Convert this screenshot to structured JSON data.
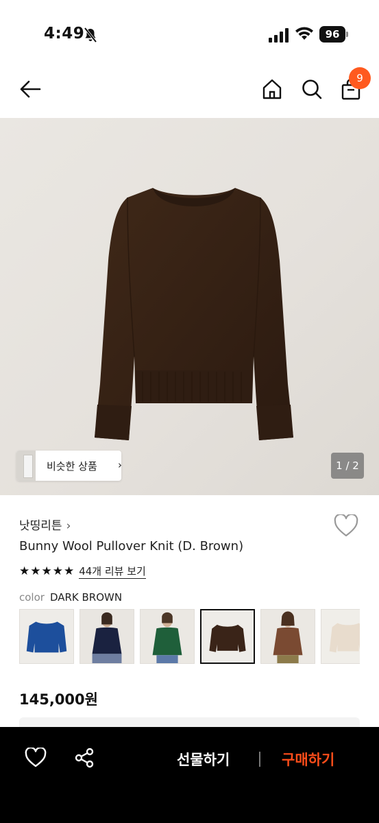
{
  "status_bar": {
    "time": "4:49",
    "battery": "96"
  },
  "nav": {
    "cart_count": "9"
  },
  "gallery": {
    "similar_label": "비슷한 상품",
    "similar_arrow": "›",
    "counter": "1 / 2"
  },
  "product": {
    "brand": "낫띵리튼",
    "brand_chevron": "›",
    "name": "Bunny Wool Pullover Knit (D. Brown)",
    "stars": "★★★★★",
    "review_link": "44개 리뷰 보기",
    "color_label": "color",
    "color_value": "DARK BROWN",
    "price": "145,000원"
  },
  "swatches": [
    {
      "color": "blue",
      "hex": "#1d4f9c"
    },
    {
      "color": "navy",
      "hex": "#1a2240"
    },
    {
      "color": "green",
      "hex": "#1f5f3a"
    },
    {
      "color": "dark-brown",
      "hex": "#3a2418",
      "selected": true
    },
    {
      "color": "brown",
      "hex": "#7a4a32"
    },
    {
      "color": "cream",
      "hex": "#e8dccd"
    }
  ],
  "bottom_bar": {
    "gift_label": "선물하기",
    "buy_label": "구매하기",
    "buy_color": "#ff4d1a"
  },
  "colors": {
    "accent": "#ff5a1f",
    "bar_bg": "#000000"
  }
}
